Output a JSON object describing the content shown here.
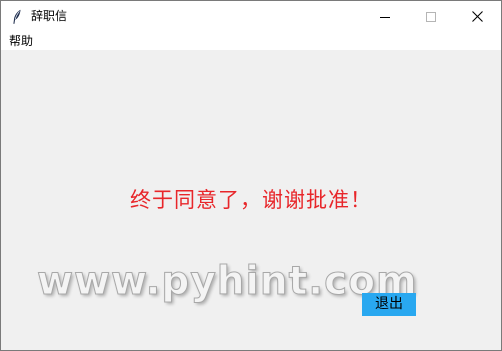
{
  "window": {
    "title": "辞职信",
    "controls": {
      "minimize_icon": "minimize-icon",
      "maximize_icon": "maximize-icon",
      "close_icon": "close-icon"
    }
  },
  "menubar": {
    "items": [
      {
        "label": "帮助"
      }
    ]
  },
  "main": {
    "message": "终于同意了，谢谢批准！",
    "message_color": "#e8262a",
    "watermark": "www.pyhint.com",
    "exit_button": {
      "label": "退出",
      "color": "#29a8f0"
    }
  },
  "colors": {
    "window_background": "#f0f0f0",
    "titlebar_background": "#ffffff"
  }
}
